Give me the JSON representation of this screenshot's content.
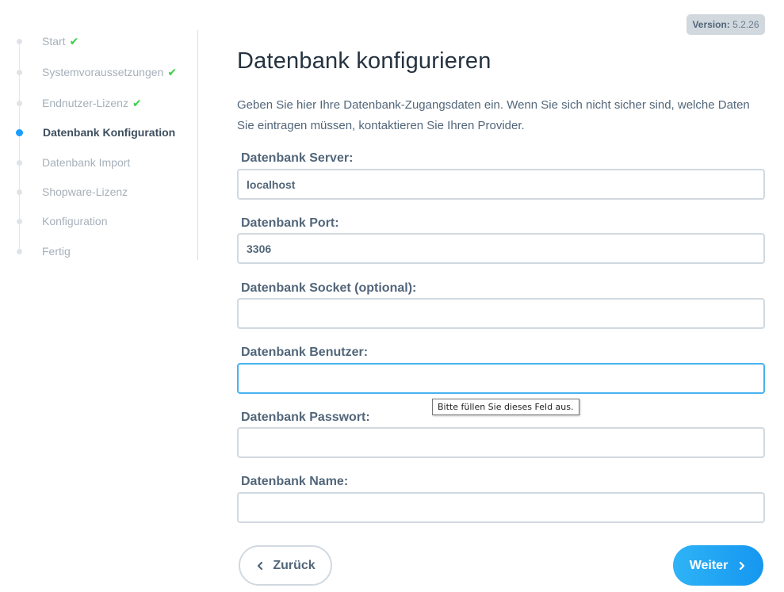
{
  "version": {
    "label": "Version:",
    "value": "5.2.26"
  },
  "sidebar": {
    "steps": [
      {
        "label": "Start",
        "done": true
      },
      {
        "label": "Systemvoraussetzungen",
        "done": true
      },
      {
        "label": "Endnutzer-Lizenz",
        "done": true
      },
      {
        "label": "Datenbank Konfiguration",
        "active": true
      },
      {
        "label": "Datenbank Import"
      },
      {
        "label": "Shopware-Lizenz"
      },
      {
        "label": "Konfiguration"
      },
      {
        "label": "Fertig"
      }
    ],
    "check_glyph": "✔"
  },
  "main": {
    "title": "Datenbank konfigurieren",
    "intro": "Geben Sie hier Ihre Datenbank-Zugangsdaten ein. Wenn Sie sich nicht sicher sind, welche Daten Sie eintragen müssen, kontaktieren Sie Ihren Provider.",
    "fields": {
      "server": {
        "label": "Datenbank Server:",
        "value": "localhost"
      },
      "port": {
        "label": "Datenbank Port:",
        "value": "3306"
      },
      "socket": {
        "label": "Datenbank Socket (optional):",
        "value": ""
      },
      "user": {
        "label": "Datenbank Benutzer:",
        "value": ""
      },
      "password": {
        "label": "Datenbank Passwort:",
        "value": ""
      },
      "name": {
        "label": "Datenbank Name:",
        "value": ""
      }
    },
    "tooltip": "Bitte füllen Sie dieses Feld aus."
  },
  "buttons": {
    "back_label": "Zurück",
    "next_label": "Weiter"
  },
  "colors": {
    "accent": "#189eff",
    "check": "#37d046",
    "focus_border": "#47b3f0"
  }
}
